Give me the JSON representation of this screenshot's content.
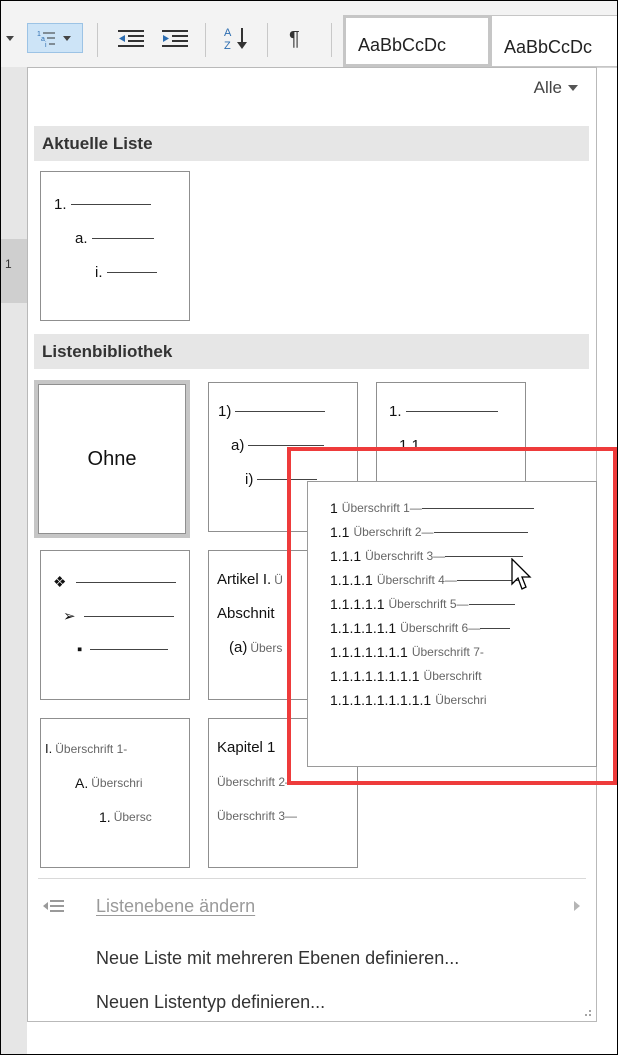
{
  "ribbon": {
    "style_previews": [
      "AaBbCcDc",
      "AaBbCcDc"
    ]
  },
  "left_strip_number": "1",
  "filter": {
    "label": "Alle",
    "icon": "dropdown-arrow-icon"
  },
  "current_list": {
    "header": "Aktuelle Liste",
    "lines": [
      "1.",
      "a.",
      "i."
    ]
  },
  "library": {
    "header": "Listenbibliothek",
    "none_label": "Ohne",
    "tile_paren": [
      "1)",
      "a)",
      "i)"
    ],
    "tile_decimal": [
      "1.",
      "1.1."
    ],
    "tile_bullets": [
      "❖",
      "➢",
      "▪"
    ],
    "tile_article": {
      "line1": "Artikel I.",
      "line1_sm": "Ü",
      "line2": "Abschnit",
      "line3": "(a)",
      "line3_sm": "Übers"
    },
    "tile_roman": [
      {
        "num": "I.",
        "text": "Überschrift 1-"
      },
      {
        "num": "A.",
        "text": "Überschri"
      },
      {
        "num": "1.",
        "text": "Übersc"
      }
    ],
    "tile_chapter": {
      "line1": "Kapitel 1",
      "line2": "Überschrift 2—",
      "line3": "Überschrift 3—"
    }
  },
  "preview_popup": {
    "lines": [
      {
        "num": "1",
        "text": "Überschrift 1—"
      },
      {
        "num": "1.1",
        "text": "Überschrift 2—"
      },
      {
        "num": "1.1.1",
        "text": "Überschrift 3—"
      },
      {
        "num": "1.1.1.1",
        "text": "Überschrift 4—"
      },
      {
        "num": "1.1.1.1.1",
        "text": "Überschrift 5—"
      },
      {
        "num": "1.1.1.1.1.1",
        "text": "Überschrift 6—"
      },
      {
        "num": "1.1.1.1.1.1.1",
        "text": "Überschrift 7-"
      },
      {
        "num": "1.1.1.1.1.1.1.1",
        "text": "Überschrift"
      },
      {
        "num": "1.1.1.1.1.1.1.1.1",
        "text": "Überschri"
      }
    ]
  },
  "menu_items": {
    "change_level": "Listenebene ändern",
    "define_multilevel": "Neue Liste mit mehreren Ebenen definieren...",
    "define_style": "Neuen Listentyp definieren..."
  },
  "colors": {
    "highlight": "#ee3b3b",
    "section_bg": "#e6e6e6",
    "disabled_text": "#9a9a9a"
  }
}
